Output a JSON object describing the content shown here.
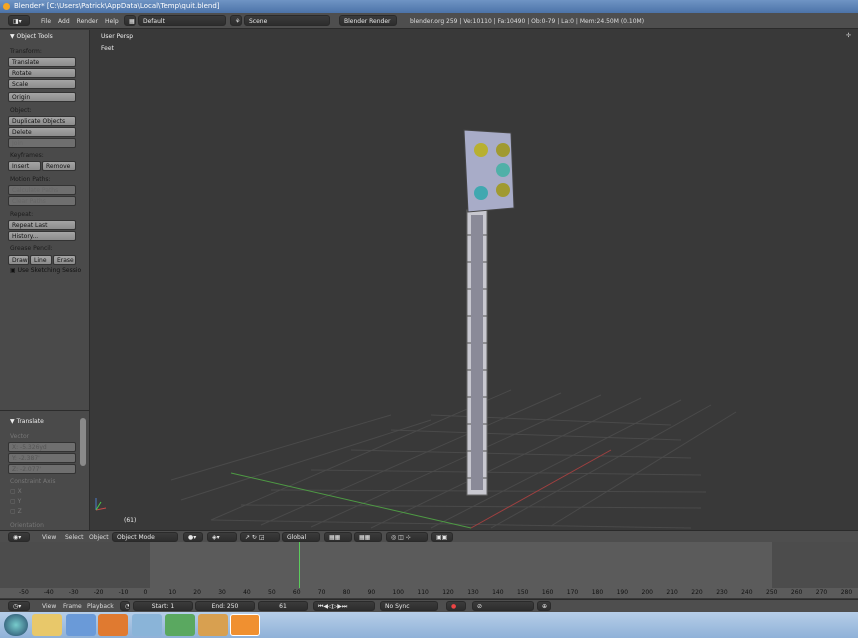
{
  "window": {
    "title": "Blender* [C:\\Users\\Patrick\\AppData\\Local\\Temp\\quit.blend]"
  },
  "header": {
    "menus": [
      "File",
      "Add",
      "Render",
      "Help"
    ],
    "layout": "Default",
    "scene": "Scene",
    "engine": "Blender Render",
    "stats": "blender.org 259 | Ve:10110 | Fa:10490 | Ob:0-79 | La:0 | Mem:24.50M (0.10M)"
  },
  "toolshelf": {
    "title": "Object Tools",
    "transform": "Transform:",
    "translate": "Translate",
    "rotate": "Rotate",
    "scale": "Scale",
    "origin": "Origin",
    "object": "Object:",
    "duplicate": "Duplicate Objects",
    "delete": "Delete",
    "join": "Join",
    "keyframes": "Keyframes:",
    "insert": "Insert",
    "remove": "Remove",
    "motion_paths": "Motion Paths:",
    "calc_paths": "Calculate Paths",
    "clear_paths": "Clear Paths",
    "repeat": "Repeat:",
    "repeat_last": "Repeat Last",
    "history": "History...",
    "grease": "Grease Pencil:",
    "draw": "Draw",
    "line": "Line",
    "erase": "Erase",
    "sketch": "Use Sketching Sessio"
  },
  "operator": {
    "title": "Translate",
    "vector": "Vector",
    "x": "X: -5.326yd",
    "y": "Y: -2.387'",
    "z": "Z: -2.077'",
    "constraint": "Constraint Axis",
    "cx": "X",
    "cy": "Y",
    "cz": "Z",
    "orientation": "Orientation"
  },
  "viewport": {
    "view_name": "User Persp",
    "units": "Feet",
    "frame": "(61)"
  },
  "view_header": {
    "menus": [
      "View",
      "Select",
      "Object"
    ],
    "mode": "Object Mode",
    "orientation": "Global"
  },
  "timeline": {
    "ticks": [
      "-50",
      "-40",
      "-30",
      "-20",
      "-10",
      "0",
      "10",
      "20",
      "30",
      "40",
      "50",
      "60",
      "70",
      "80",
      "90",
      "100",
      "110",
      "120",
      "130",
      "140",
      "150",
      "160",
      "170",
      "180",
      "190",
      "200",
      "210",
      "220",
      "230",
      "240",
      "250",
      "260",
      "270",
      "280"
    ]
  },
  "timeline_header": {
    "menus": [
      "View",
      "Frame",
      "Playback"
    ],
    "start": "Start: 1",
    "end": "End: 250",
    "current": "61",
    "sync": "No Sync"
  }
}
